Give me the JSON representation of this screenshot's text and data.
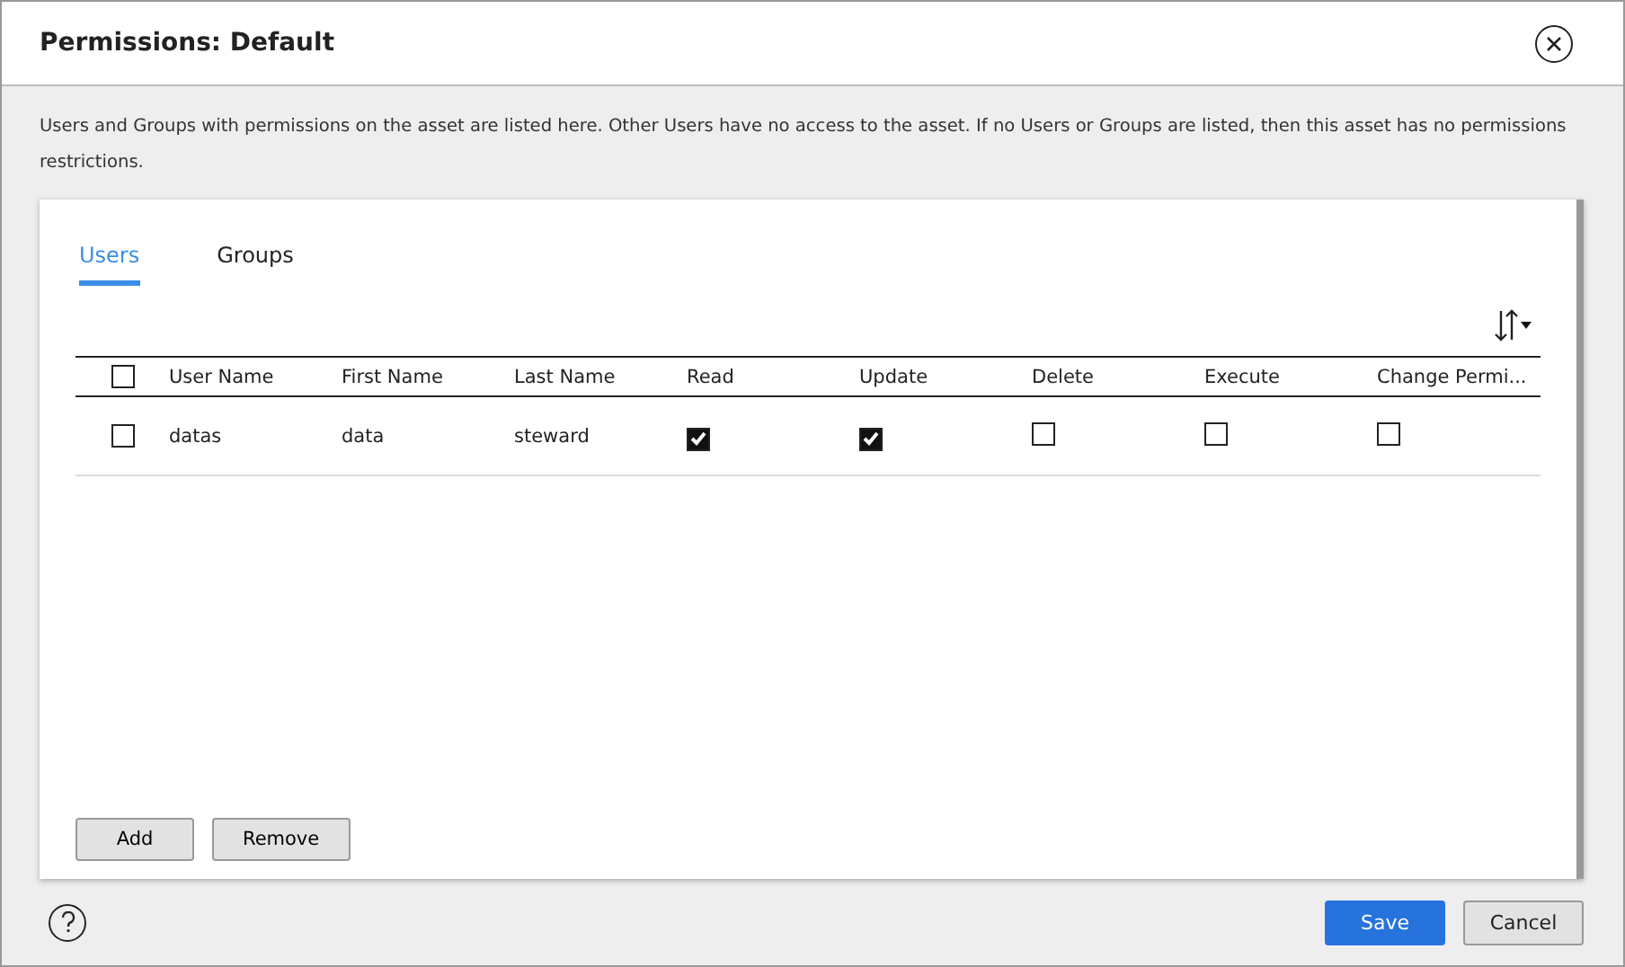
{
  "dialog": {
    "title": "Permissions: Default"
  },
  "description": "Users and Groups with permissions on the asset are listed here. Other Users have no access to the asset. If no Users or Groups are listed, then this asset has no permissions restrictions.",
  "tabs": [
    {
      "label": "Users",
      "selected": true
    },
    {
      "label": "Groups",
      "selected": false
    }
  ],
  "table": {
    "select_all_checked": false,
    "columns": [
      "User Name",
      "First Name",
      "Last Name",
      "Read",
      "Update",
      "Delete",
      "Execute",
      "Change Permi..."
    ],
    "rows": [
      {
        "checked": false,
        "user_name": "datas",
        "first_name": "data",
        "last_name": "steward",
        "permissions": [
          {
            "checked": true
          },
          {
            "checked": true
          },
          {
            "checked": false
          },
          {
            "checked": false
          },
          {
            "checked": false
          }
        ]
      }
    ]
  },
  "panel_buttons": [
    "Add",
    "Remove"
  ],
  "footer_buttons": [
    {
      "label": "Save",
      "kind": "primary"
    },
    {
      "label": "Cancel",
      "kind": "secondary"
    }
  ]
}
